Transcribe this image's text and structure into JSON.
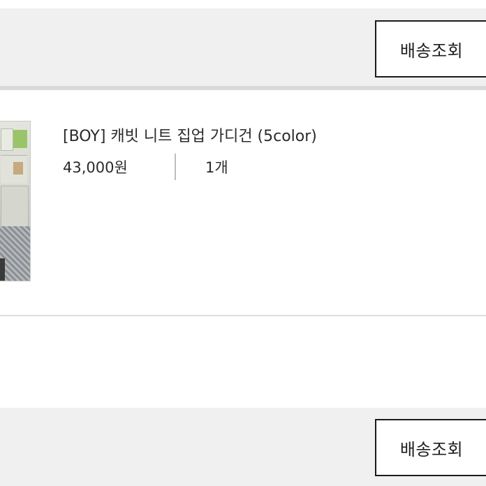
{
  "order_top": {
    "track_button_label": "배송조회"
  },
  "product": {
    "title": "[BOY] 캐빗 니트 집업 가디건 (5color)",
    "price": "43,000원",
    "quantity": "1개"
  },
  "order_bottom": {
    "track_button_label": "배송조회"
  }
}
